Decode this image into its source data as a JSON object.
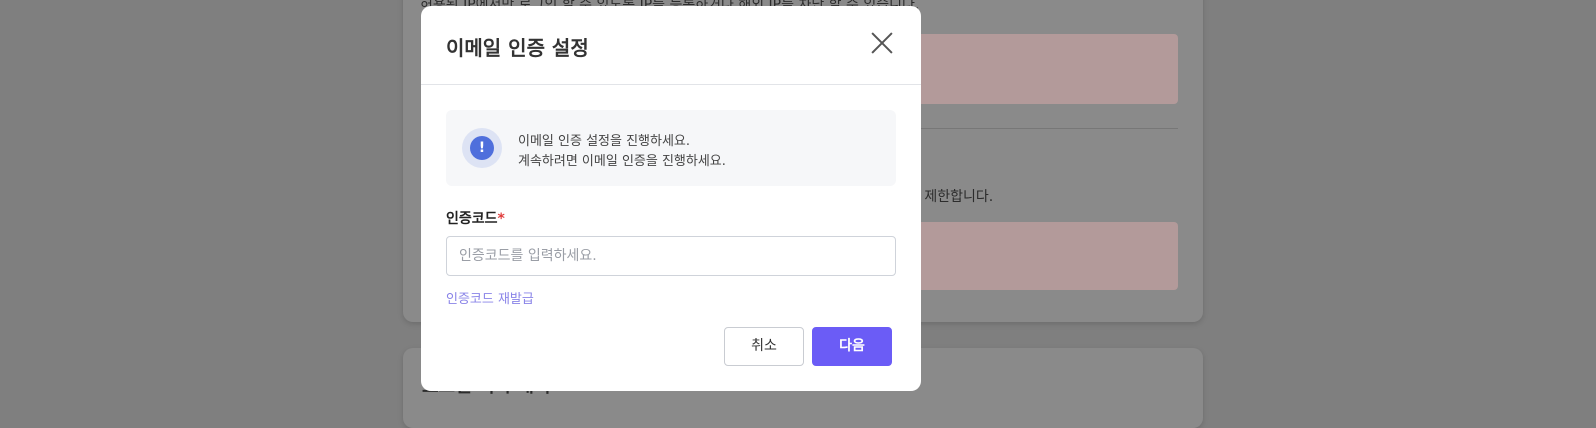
{
  "background": {
    "top_text": "허용된 IP에서만 로그인 할 수 있도록 IP를 등록하거나 해외 IP를 차단 할 수 있습니다.",
    "side_text": "를 제한합니다.",
    "bottom_heading": "로그인 기록 내역"
  },
  "modal": {
    "title": "이메일 인증 설정",
    "close_icon": "close-icon",
    "info": {
      "icon": "exclamation-icon",
      "line1": "이메일 인증 설정을 진행하세요.",
      "line2": "계속하려면 이메일 인증을 진행하세요."
    },
    "field": {
      "label": "인증코드",
      "required_mark": "*",
      "value": "",
      "placeholder": "인증코드를 입력하세요."
    },
    "resend_link": "인증코드 재발급",
    "buttons": {
      "cancel": "취소",
      "next": "다음"
    }
  },
  "colors": {
    "primary": "#6b5cf6",
    "link": "#8a84e8",
    "required": "#e03c3c",
    "info_icon": "#4f6fdc"
  }
}
